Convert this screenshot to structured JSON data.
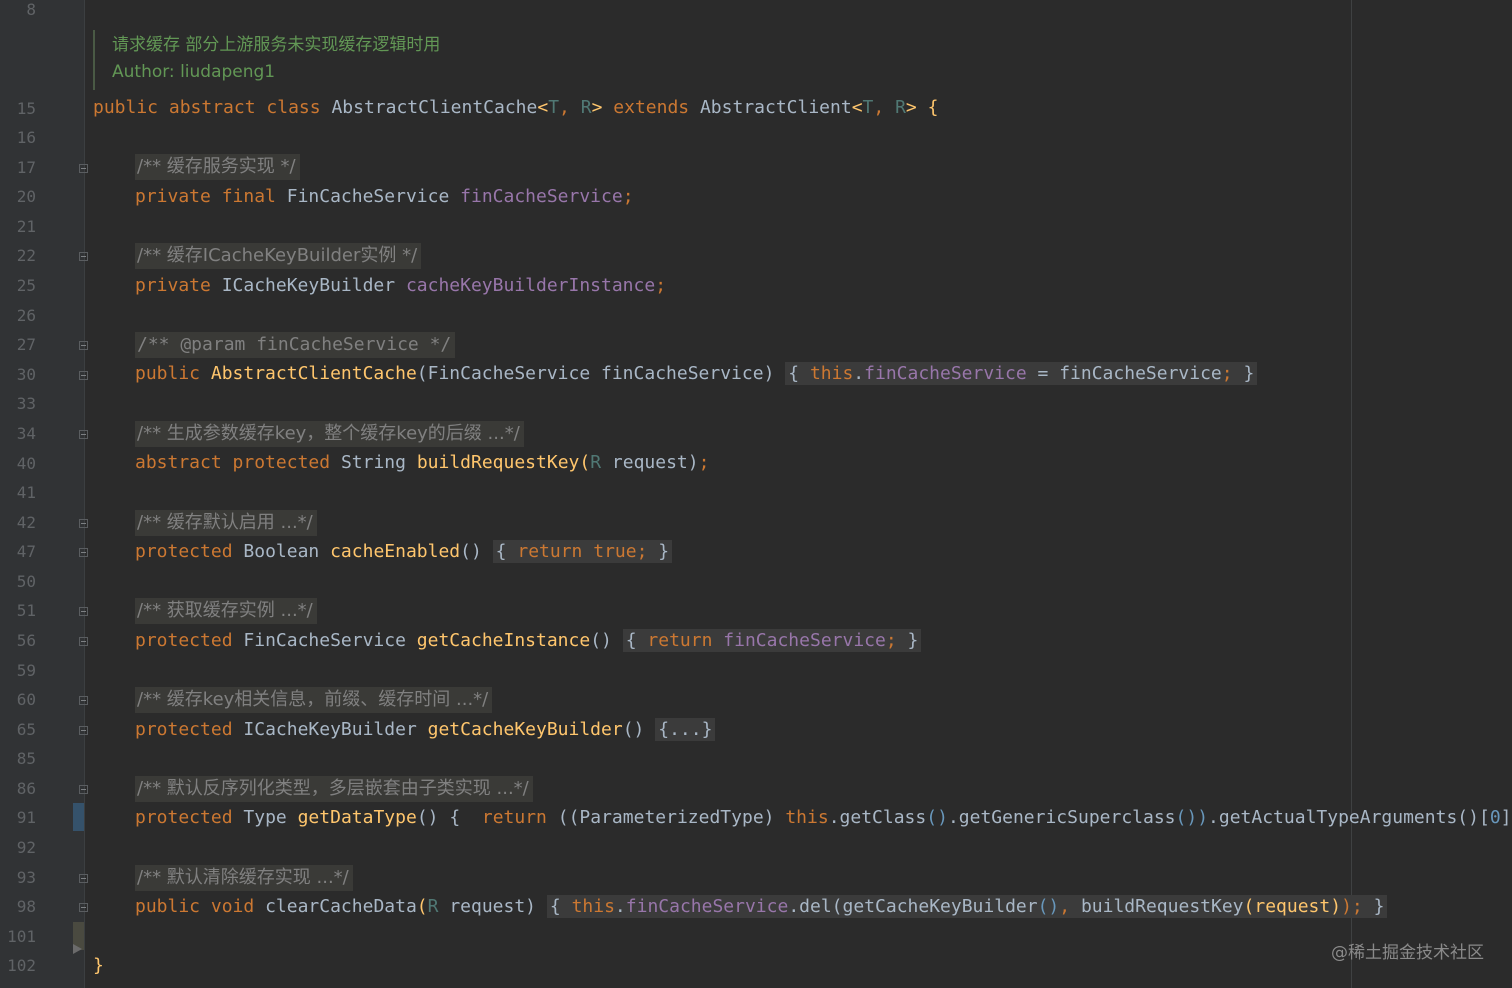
{
  "gutter": {
    "line_numbers": [
      "8",
      "15",
      "16",
      "17",
      "20",
      "21",
      "22",
      "25",
      "26",
      "27",
      "30",
      "33",
      "34",
      "40",
      "41",
      "42",
      "47",
      "50",
      "51",
      "56",
      "59",
      "60",
      "65",
      "85",
      "86",
      "91",
      "92",
      "93",
      "98",
      "101",
      "102"
    ]
  },
  "doc": {
    "line1": "请求缓存 部分上游服务未实现缓存逻辑时用",
    "line2": "Author: liudapeng1"
  },
  "code": {
    "l15": {
      "public": "public",
      "abstract": "abstract",
      "class": "class",
      "name": "AbstractClientCache",
      "lt": "<",
      "T": "T",
      "comma": ", ",
      "R": "R",
      "gt": ">",
      "extends": "extends",
      "parent": "AbstractClient",
      "lt2": "<",
      "T2": "T",
      "comma2": ", ",
      "R2": "R",
      "gt2": ">",
      "brace": " {"
    },
    "c17": "/** 缓存服务实现 */",
    "l20": {
      "private": "private",
      "final": "final",
      "type": "FinCacheService",
      "field": "finCacheService",
      "semi": ";"
    },
    "c22": "/** 缓存ICacheKeyBuilder实例 */",
    "l25": {
      "private": "private",
      "type": "ICacheKeyBuilder",
      "field": "cacheKeyBuilderInstance",
      "semi": ";"
    },
    "c27": "/** @param finCacheService */",
    "l30": {
      "public": "public",
      "name": "AbstractClientCache",
      "params": "(FinCacheService finCacheService)",
      "open": "{",
      "this": "this",
      "dot": ".",
      "field": "finCacheService",
      "assign": " = finCacheService",
      "semi": ";",
      "close": "}"
    },
    "c34": "/** 生成参数缓存key，整个缓存key的后缀 ...*/",
    "l40": {
      "abstract": "abstract",
      "protected": "protected",
      "type": "String",
      "name": "buildRequestKey",
      "po": "(",
      "R": "R",
      "rest": " request)",
      "semi": ";"
    },
    "c42": "/** 缓存默认启用 ...*/",
    "l47": {
      "protected": "protected",
      "type": "Boolean",
      "name": "cacheEnabled",
      "paren": "()",
      "open": "{",
      "return": "return",
      "true": "true",
      "semi": ";",
      "close": "}"
    },
    "c51": "/** 获取缓存实例 ...*/",
    "l56": {
      "protected": "protected",
      "type": "FinCacheService",
      "name": "getCacheInstance",
      "paren": "()",
      "open": "{",
      "return": "return",
      "field": "finCacheService",
      "semi": ";",
      "close": "}"
    },
    "c60": "/** 缓存key相关信息，前缀、缓存时间 ...*/",
    "l65": {
      "protected": "protected",
      "type": "ICacheKeyBuilder",
      "name": "getCacheKeyBuilder",
      "paren": "()",
      "folded": "{...}"
    },
    "c86": "/** 默认反序列化类型，多层嵌套由子类实现 ...*/",
    "l91": {
      "protected": "protected",
      "type": "Type",
      "name": "getDataType",
      "paren": "()",
      "open": "{",
      "return": "return",
      "cast_open": "((ParameterizedType)",
      "this": "this",
      "chain1": ".getClass",
      "p1": "()",
      "chain2": ".getGenericSuperclass",
      "p2": "())",
      "chain3": ".getActualTypeArguments",
      "p3": "()",
      "idx_open": "[",
      "idx": "0",
      "idx_close": "]",
      "semi": ";",
      "close": "}"
    },
    "c93": "/** 默认清除缓存实现 ...*/",
    "l98": {
      "public": "public",
      "void": "void",
      "name": "clearCacheData",
      "po": "(",
      "R": "R",
      "rest": " request)",
      "open": "{",
      "this": "this",
      "dot": ".",
      "field": "finCacheService",
      "call": ".del(getCacheKeyBuilder",
      "p1": "()",
      "comma": ", ",
      "call2": "buildRequestKey",
      "p2": "(request)",
      "end": ");",
      "close": "}"
    },
    "l102": "}"
  },
  "watermark": "@稀土掘金技术社区",
  "colors": {
    "background": "#2b2b2b",
    "keyword": "#cc7832",
    "method": "#ffc66d",
    "field": "#9876aa",
    "comment": "#808080",
    "doc": "#629755",
    "number": "#6897bb"
  }
}
